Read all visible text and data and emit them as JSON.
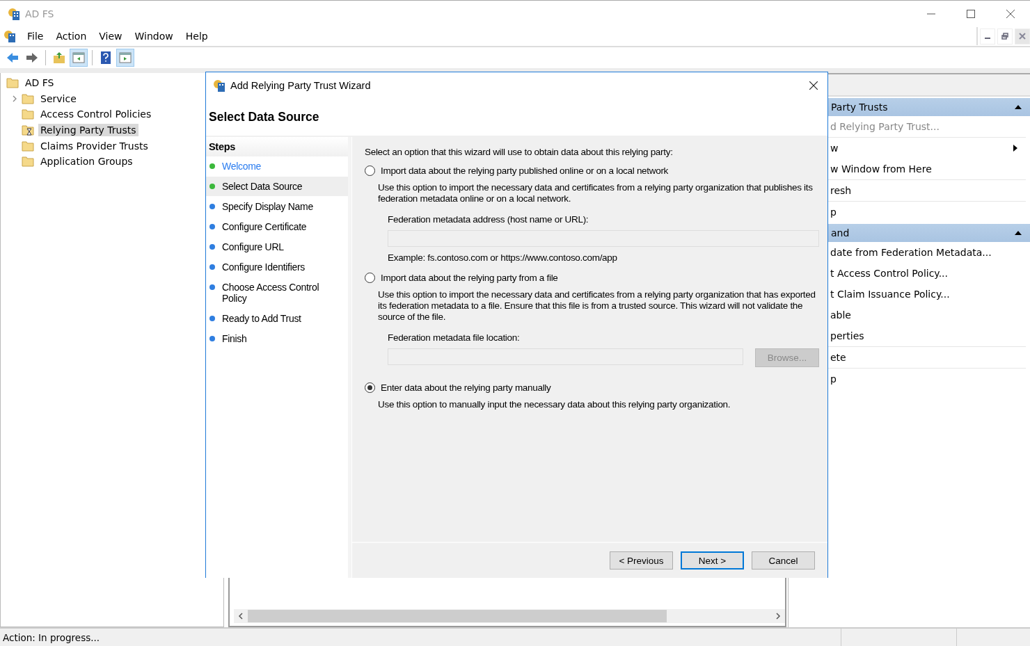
{
  "window": {
    "title": "AD FS"
  },
  "menu": [
    "File",
    "Action",
    "View",
    "Window",
    "Help"
  ],
  "tree": {
    "label": "AD FS",
    "children": [
      {
        "label": "Service",
        "collapsed": true,
        "selected": false,
        "busy": false
      },
      {
        "label": "Access Control Policies",
        "collapsed": false,
        "selected": false,
        "busy": false
      },
      {
        "label": "Relying Party Trusts",
        "collapsed": false,
        "selected": true,
        "busy": true
      },
      {
        "label": "Claims Provider Trusts",
        "collapsed": false,
        "selected": false,
        "busy": false
      },
      {
        "label": "Application Groups",
        "collapsed": false,
        "selected": false,
        "busy": false
      }
    ]
  },
  "actions": [
    {
      "title": "Party Trusts",
      "items": [
        {
          "label": "d Relying Party Trust...",
          "disabled": true,
          "submenu": false,
          "divider": true
        },
        {
          "label": "w",
          "disabled": false,
          "submenu": true,
          "divider": false
        },
        {
          "label": "w Window from Here",
          "disabled": false,
          "submenu": false,
          "divider": true
        },
        {
          "label": "resh",
          "disabled": false,
          "submenu": false,
          "divider": true
        },
        {
          "label": "p",
          "disabled": false,
          "submenu": false,
          "divider": false
        }
      ]
    },
    {
      "title": "and",
      "items": [
        {
          "label": "date from Federation Metadata...",
          "disabled": false,
          "submenu": false,
          "divider": false
        },
        {
          "label": "t Access Control Policy...",
          "disabled": false,
          "submenu": false,
          "divider": false
        },
        {
          "label": "t Claim Issuance Policy...",
          "disabled": false,
          "submenu": false,
          "divider": false
        },
        {
          "label": "able",
          "disabled": false,
          "submenu": false,
          "divider": false
        },
        {
          "label": "perties",
          "disabled": false,
          "submenu": false,
          "divider": true
        },
        {
          "label": "ete",
          "disabled": false,
          "submenu": false,
          "divider": true
        },
        {
          "label": "p",
          "disabled": false,
          "submenu": false,
          "divider": false
        }
      ]
    }
  ],
  "wizard": {
    "title": "Add Relying Party Trust Wizard",
    "page_title": "Select Data Source",
    "steps_heading": "Steps",
    "steps": [
      {
        "label": "Welcome",
        "color": "#3cb83c",
        "link": true,
        "selected": false
      },
      {
        "label": "Select Data Source",
        "color": "#3cb83c",
        "link": false,
        "selected": true
      },
      {
        "label": "Specify Display Name",
        "color": "#2f7ee0",
        "link": false,
        "selected": false
      },
      {
        "label": "Configure Certificate",
        "color": "#2f7ee0",
        "link": false,
        "selected": false
      },
      {
        "label": "Configure URL",
        "color": "#2f7ee0",
        "link": false,
        "selected": false
      },
      {
        "label": "Configure Identifiers",
        "color": "#2f7ee0",
        "link": false,
        "selected": false
      },
      {
        "label": "Choose Access Control Policy",
        "color": "#2f7ee0",
        "link": false,
        "selected": false
      },
      {
        "label": "Ready to Add Trust",
        "color": "#2f7ee0",
        "link": false,
        "selected": false
      },
      {
        "label": "Finish",
        "color": "#2f7ee0",
        "link": false,
        "selected": false
      }
    ],
    "intro": "Select an option that this wizard will use to obtain data about this relying party:",
    "options": [
      {
        "label": "Import data about the relying party published online or on a local network",
        "selected": false,
        "description": "Use this option to import the necessary data and certificates from a relying party organization that publishes its federation metadata online or on a local network.",
        "field_label": "Federation metadata address (host name or URL):",
        "example": "Example: fs.contoso.com or https://www.contoso.com/app"
      },
      {
        "label": "Import data about the relying party from a file",
        "selected": false,
        "description": "Use this option to import the necessary data and certificates from a relying party organization that has exported its federation metadata to a file. Ensure that this file is from a trusted source.  This wizard will not validate the source of the file.",
        "field_label": "Federation metadata file location:",
        "browse": {
          "label": "Browse...",
          "disabled": true
        }
      },
      {
        "label": "Enter data about the relying party manually",
        "selected": true,
        "description": "Use this option to manually input the necessary data about this relying party organization."
      }
    ],
    "buttons": [
      {
        "label": "< Previous",
        "default": false
      },
      {
        "label": "Next >",
        "default": true
      },
      {
        "label": "Cancel",
        "default": false
      }
    ]
  },
  "status_bar": {
    "text": "Action:  In progress..."
  }
}
